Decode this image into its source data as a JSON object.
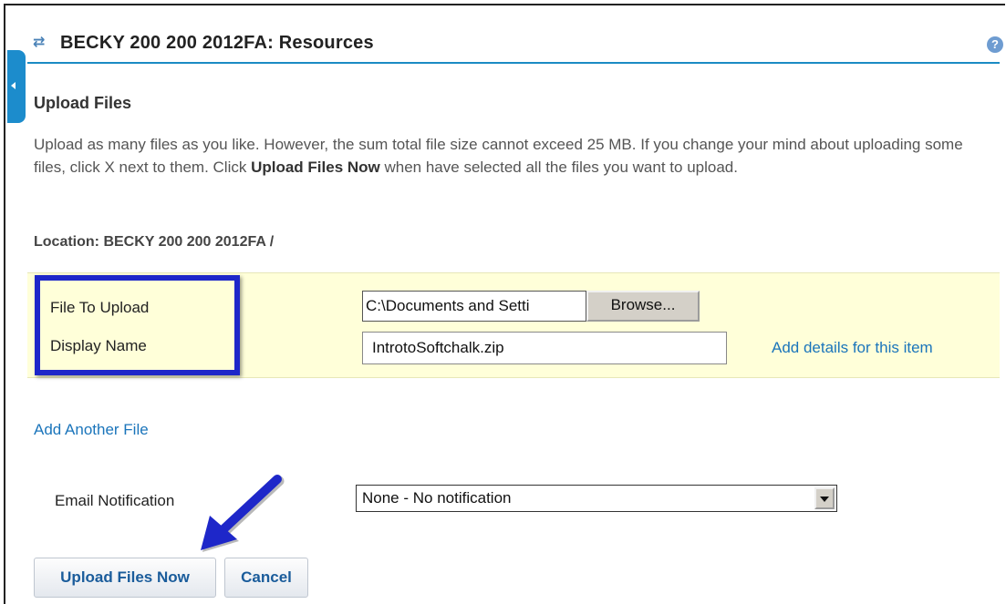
{
  "header": {
    "title": "BECKY 200 200 2012FA: Resources",
    "help_glyph": "?"
  },
  "upload": {
    "section_title": "Upload Files",
    "description_part1": "Upload as many files as you like. However, the sum total file size cannot exceed 25 MB. If you change your mind about uploading some files, click X next to them. Click ",
    "description_bold": "Upload Files Now",
    "description_part2": " when have selected all the files you want to upload.",
    "location": "Location: BECKY 200 200 2012FA /",
    "file_label": "File To Upload",
    "file_value": "C:\\Documents and Setti",
    "browse_label": "Browse...",
    "display_label": "Display Name",
    "display_value": "IntrotoSoftchalk.zip",
    "details_link": "Add details for this item",
    "add_another_link": "Add Another File"
  },
  "notification": {
    "label": "Email Notification",
    "selected": "None - No notification"
  },
  "actions": {
    "upload_now": "Upload Files Now",
    "cancel": "Cancel"
  },
  "colors": {
    "accent": "#1b8bc4",
    "link": "#1b75bb",
    "highlight_box": "#1e27c9",
    "row_background": "#ffffd9"
  }
}
